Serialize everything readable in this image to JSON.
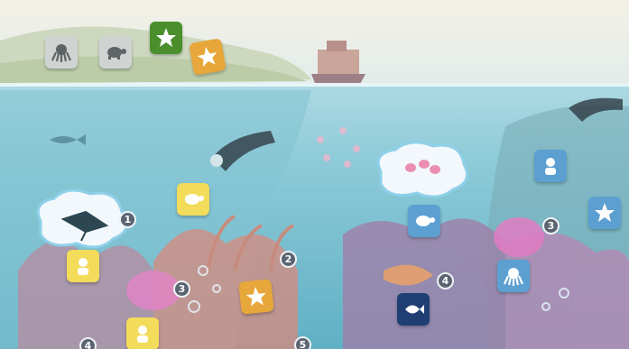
{
  "colors": {
    "sky": "#eef0e4",
    "sea_surface": "#cfe9ef",
    "sea_deep": "#6fb7c9",
    "tile_gray": "#cfd3d2",
    "tile_green": "#4a8f2c",
    "tile_orange": "#e8a73a",
    "tile_yellow": "#f2dc5a",
    "tile_blue": "#5c9fd1",
    "tile_navy": "#1f3f73",
    "badge": "#5b6470"
  },
  "tiles": [
    {
      "name": "octopus-tile-gray",
      "icon": "octopus-icon",
      "style": "gray"
    },
    {
      "name": "turtle-tile-gray",
      "icon": "turtle-icon",
      "style": "gray"
    },
    {
      "name": "star-tile-green",
      "icon": "star-icon",
      "style": "green"
    },
    {
      "name": "star-tile-orange-top",
      "icon": "star-icon",
      "style": "orange"
    },
    {
      "name": "turtle-tile-yellow",
      "icon": "turtle-icon",
      "style": "yellow"
    },
    {
      "name": "diver-tile-yellow",
      "icon": "diver-icon",
      "style": "yellow"
    },
    {
      "name": "star-tile-orange",
      "icon": "star-icon",
      "style": "orange"
    },
    {
      "name": "turtle-tile-blue",
      "icon": "turtle-icon",
      "style": "blue"
    },
    {
      "name": "diver-tile-blue",
      "icon": "diver-icon",
      "style": "blue"
    },
    {
      "name": "star-tile-blue",
      "icon": "star-icon",
      "style": "blue"
    },
    {
      "name": "octopus-tile-blue",
      "icon": "octopus-icon",
      "style": "blue"
    },
    {
      "name": "fish-tile-navy",
      "icon": "fish-icon",
      "style": "navy"
    },
    {
      "name": "diver-tile-yellow-bottom",
      "icon": "diver-icon",
      "style": "yellow"
    }
  ],
  "badges": [
    "1",
    "2",
    "3",
    "3",
    "4",
    "4",
    "5"
  ]
}
